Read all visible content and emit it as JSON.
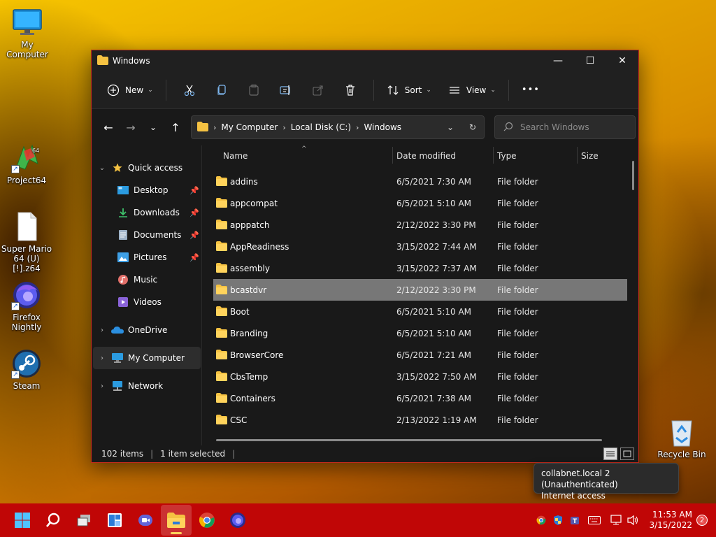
{
  "desktop": {
    "icons": [
      {
        "label": "My Computer"
      },
      {
        "label": "Project64"
      },
      {
        "label": "Super Mario 64 (U) [!].z64"
      },
      {
        "label": "Firefox Nightly"
      },
      {
        "label": "Steam"
      },
      {
        "label": "Recycle Bin"
      }
    ]
  },
  "window": {
    "title": "Windows",
    "controls": {
      "minimize": "—",
      "maximize": "☐",
      "close": "✕"
    },
    "toolbar": {
      "new_label": "New",
      "sort_label": "Sort",
      "view_label": "View",
      "more_label": "•••"
    },
    "address": {
      "crumbs": [
        "My Computer",
        "Local Disk (C:)",
        "Windows"
      ]
    },
    "search": {
      "placeholder": "Search Windows"
    },
    "nav": {
      "quick_access": "Quick access",
      "desktop": "Desktop",
      "downloads": "Downloads",
      "documents": "Documents",
      "pictures": "Pictures",
      "music": "Music",
      "videos": "Videos",
      "onedrive": "OneDrive",
      "my_computer": "My Computer",
      "network": "Network"
    },
    "columns": {
      "name": "Name",
      "date": "Date modified",
      "type": "Type",
      "size": "Size"
    },
    "files": [
      {
        "name": "addins",
        "date": "6/5/2021 7:30 AM",
        "type": "File folder"
      },
      {
        "name": "appcompat",
        "date": "6/5/2021 5:10 AM",
        "type": "File folder"
      },
      {
        "name": "apppatch",
        "date": "2/12/2022 3:30 PM",
        "type": "File folder"
      },
      {
        "name": "AppReadiness",
        "date": "3/15/2022 7:44 AM",
        "type": "File folder"
      },
      {
        "name": "assembly",
        "date": "3/15/2022 7:37 AM",
        "type": "File folder"
      },
      {
        "name": "bcastdvr",
        "date": "2/12/2022 3:30 PM",
        "type": "File folder"
      },
      {
        "name": "Boot",
        "date": "6/5/2021 5:10 AM",
        "type": "File folder"
      },
      {
        "name": "Branding",
        "date": "6/5/2021 5:10 AM",
        "type": "File folder"
      },
      {
        "name": "BrowserCore",
        "date": "6/5/2021 7:21 AM",
        "type": "File folder"
      },
      {
        "name": "CbsTemp",
        "date": "3/15/2022 7:50 AM",
        "type": "File folder"
      },
      {
        "name": "Containers",
        "date": "6/5/2021 7:38 AM",
        "type": "File folder"
      },
      {
        "name": "CSC",
        "date": "2/13/2022 1:19 AM",
        "type": "File folder"
      }
    ],
    "selected_file": "bcastdvr",
    "status": {
      "count": "102 items",
      "selection": "1 item selected"
    }
  },
  "tooltip": {
    "line1": "collabnet.local 2 (Unauthenticated)",
    "line2": "Internet access"
  },
  "taskbar": {
    "time": "11:53 AM",
    "date": "3/15/2022",
    "notifications": "2"
  },
  "colors": {
    "taskbar": "#c00606",
    "window_border": "#c42b1c",
    "folder": "#f5c242",
    "selection": "#777777"
  }
}
